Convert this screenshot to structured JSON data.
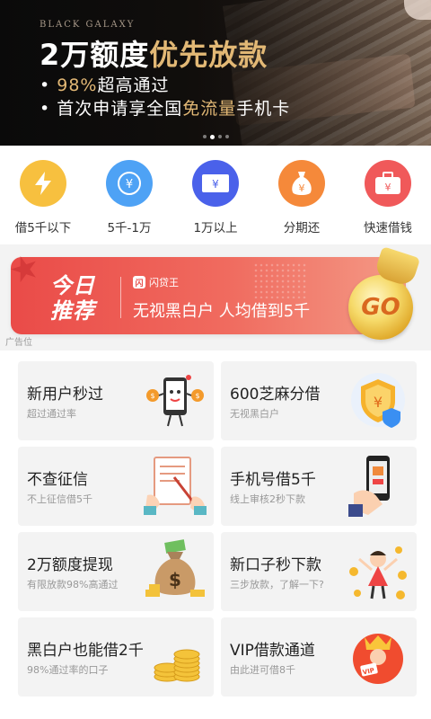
{
  "banner": {
    "brand": "BLACK GALAXY",
    "headline_white": "2万额度",
    "headline_gold": "优先放款",
    "bullet1_prefix": "• ",
    "bullet1_gold": "98%",
    "bullet1_rest": "超高通过",
    "bullet2_prefix": "• 首次申请享全国",
    "bullet2_gold": "免流量",
    "bullet2_rest": "手机卡",
    "active_dot": 1,
    "dot_count": 4
  },
  "categories": [
    {
      "label": "借5千以下",
      "icon": "lightning-icon",
      "color": "#f7c03f"
    },
    {
      "label": "5千-1万",
      "icon": "yen-coin-icon",
      "color": "#4ea2f5"
    },
    {
      "label": "1万以上",
      "icon": "banknote-icon",
      "color": "#4a61ea"
    },
    {
      "label": "分期还",
      "icon": "money-bag-icon",
      "color": "#f5893a"
    },
    {
      "label": "快速借钱",
      "icon": "briefcase-icon",
      "color": "#f0595a"
    }
  ],
  "ad": {
    "title": "今日推荐",
    "app_logo": "闪",
    "app_name": "闪贷王",
    "text": "无视黑白户 人均借到5千",
    "go": "GO",
    "label": "广告位"
  },
  "products": [
    {
      "title": "新用户秒过",
      "subtitle": "超过通过率",
      "icon": "phone-mascot-icon"
    },
    {
      "title": "600芝麻分借",
      "subtitle": "无视黑白户",
      "icon": "shield-yen-icon"
    },
    {
      "title": "不查征信",
      "subtitle": "不上征信借5千",
      "icon": "document-pen-icon"
    },
    {
      "title": "手机号借5千",
      "subtitle": "线上审核2秒下款",
      "icon": "hand-phone-icon"
    },
    {
      "title": "2万额度提现",
      "subtitle": "有限放款98%高通过",
      "icon": "dollar-bag-icon"
    },
    {
      "title": "新口子秒下款",
      "subtitle": "三步放款，了解一下?",
      "icon": "cheering-man-icon"
    },
    {
      "title": "黑白户也能借2千",
      "subtitle": "98%通过率的口子",
      "icon": "coin-stack-icon"
    },
    {
      "title": "VIP借款通道",
      "subtitle": "由此进可借8千",
      "icon": "vip-king-icon"
    }
  ]
}
